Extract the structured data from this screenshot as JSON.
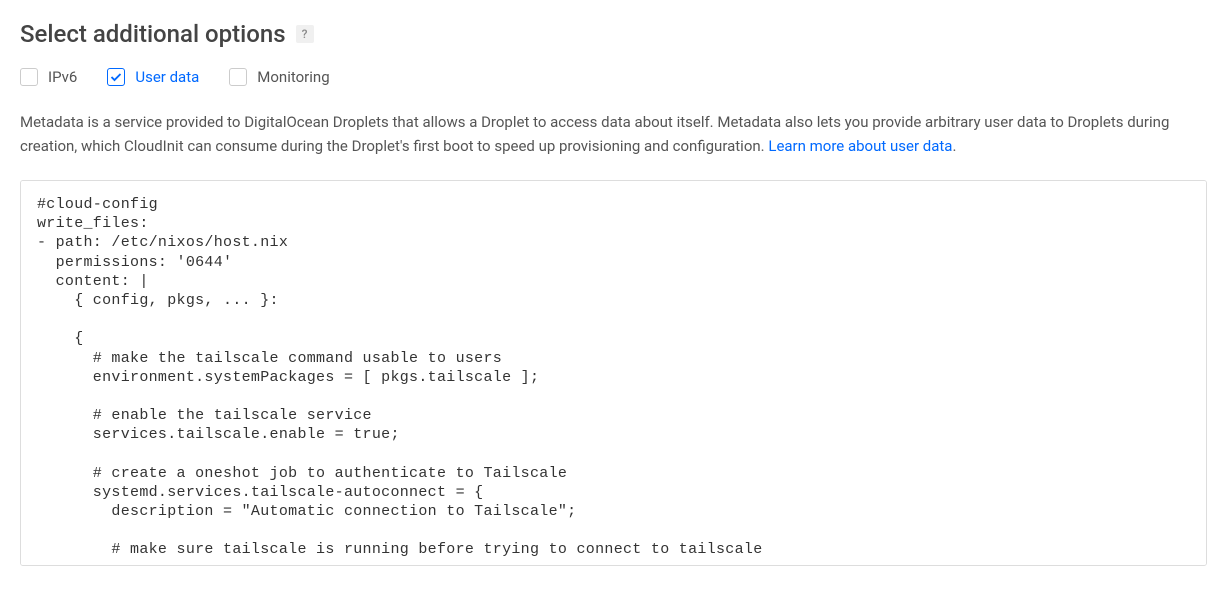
{
  "header": {
    "title": "Select additional options",
    "help_symbol": "?"
  },
  "options": {
    "ipv6": {
      "label": "IPv6",
      "checked": false
    },
    "userdata": {
      "label": "User data",
      "checked": true
    },
    "monitoring": {
      "label": "Monitoring",
      "checked": false
    }
  },
  "description": {
    "text": "Metadata is a service provided to DigitalOcean Droplets that allows a Droplet to access data about itself. Metadata also lets you provide arbitrary user data to Droplets during creation, which CloudInit can consume during the Droplet's first boot to speed up provisioning and configuration. ",
    "link_text": "Learn more about user data",
    "period": "."
  },
  "userdata_content": "#cloud-config\nwrite_files:\n- path: /etc/nixos/host.nix\n  permissions: '0644'\n  content: |\n    { config, pkgs, ... }:\n\n    {\n      # make the tailscale command usable to users\n      environment.systemPackages = [ pkgs.tailscale ];\n\n      # enable the tailscale service\n      services.tailscale.enable = true;\n\n      # create a oneshot job to authenticate to Tailscale\n      systemd.services.tailscale-autoconnect = {\n        description = \"Automatic connection to Tailscale\";\n\n        # make sure tailscale is running before trying to connect to tailscale\n"
}
